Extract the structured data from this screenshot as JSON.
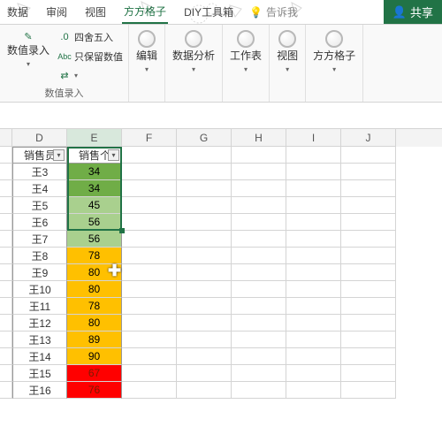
{
  "tabs": {
    "t0": "数据",
    "t1": "审阅",
    "t2": "视图",
    "t3": "方方格子",
    "t4": "DIY工具箱",
    "tellme": "告诉我",
    "share": "共享"
  },
  "ribbon": {
    "numInput": "数值录入",
    "round": "四舍五入",
    "keepNum": "只保留数值",
    "convert": "...",
    "groupNumInput": "数值录入",
    "edit": "编辑",
    "dataAnalysis": "数据分析",
    "worksheet": "工作表",
    "view": "视图",
    "ffgz": "方方格子"
  },
  "cols": {
    "D": "D",
    "E": "E",
    "F": "F",
    "G": "G",
    "H": "H",
    "I": "I",
    "J": "J"
  },
  "headers": {
    "seller": "销售员",
    "count": "销售个"
  },
  "rows": [
    {
      "s": "王3",
      "v": "34",
      "c": "green"
    },
    {
      "s": "王4",
      "v": "34",
      "c": "green"
    },
    {
      "s": "王5",
      "v": "45",
      "c": "lgreen"
    },
    {
      "s": "王6",
      "v": "56",
      "c": "lgreen"
    },
    {
      "s": "王7",
      "v": "56",
      "c": "lgreen"
    },
    {
      "s": "王8",
      "v": "78",
      "c": "orange"
    },
    {
      "s": "王9",
      "v": "80",
      "c": "orange"
    },
    {
      "s": "王10",
      "v": "80",
      "c": "orange"
    },
    {
      "s": "王11",
      "v": "78",
      "c": "orange"
    },
    {
      "s": "王12",
      "v": "80",
      "c": "orange"
    },
    {
      "s": "王13",
      "v": "89",
      "c": "orange"
    },
    {
      "s": "王14",
      "v": "90",
      "c": "orange"
    },
    {
      "s": "王15",
      "v": "67",
      "c": "red"
    },
    {
      "s": "王16",
      "v": "76",
      "c": "red"
    }
  ],
  "colWidths": {
    "D": 62,
    "E": 62,
    "other": 62
  },
  "chart_data": {
    "type": "table",
    "title": "",
    "columns": [
      "销售员",
      "销售个"
    ],
    "data": [
      [
        "王3",
        34
      ],
      [
        "王4",
        34
      ],
      [
        "王5",
        45
      ],
      [
        "王6",
        56
      ],
      [
        "王7",
        56
      ],
      [
        "王8",
        78
      ],
      [
        "王9",
        80
      ],
      [
        "王10",
        80
      ],
      [
        "王11",
        78
      ],
      [
        "王12",
        80
      ],
      [
        "王13",
        89
      ],
      [
        "王14",
        90
      ],
      [
        "王15",
        67
      ],
      [
        "王16",
        76
      ]
    ]
  }
}
